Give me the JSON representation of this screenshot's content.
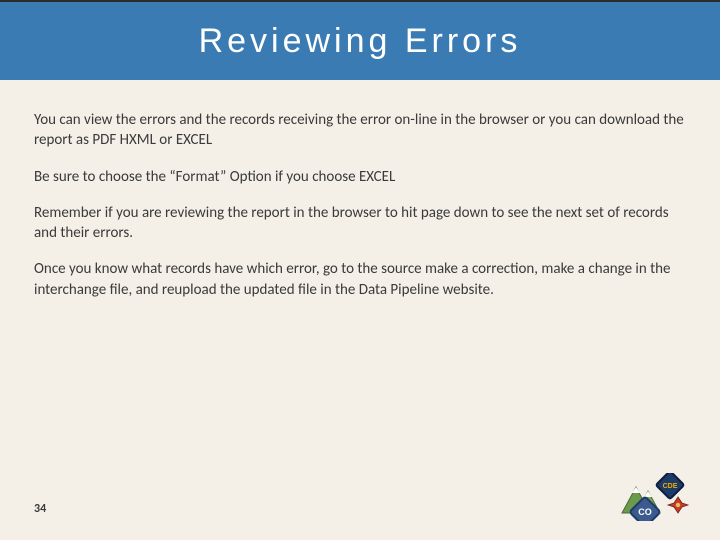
{
  "header": {
    "title": "Reviewing Errors"
  },
  "paragraphs": [
    "You can view the errors and the records receiving the error on-line in the browser or you can download the report as PDF HXML or EXCEL",
    "Be sure to choose the “Format” Option if you choose EXCEL",
    "Remember if you are reviewing the report in the browser to hit page down to see the next set of records and their errors.",
    "Once you know what records have which error, go to the source make a correction, make a change in the interchange file, and reupload the updated file in the Data Pipeline website."
  ],
  "page_number": "34",
  "logo": {
    "co_text": "CO",
    "cde_text": "CDE"
  }
}
